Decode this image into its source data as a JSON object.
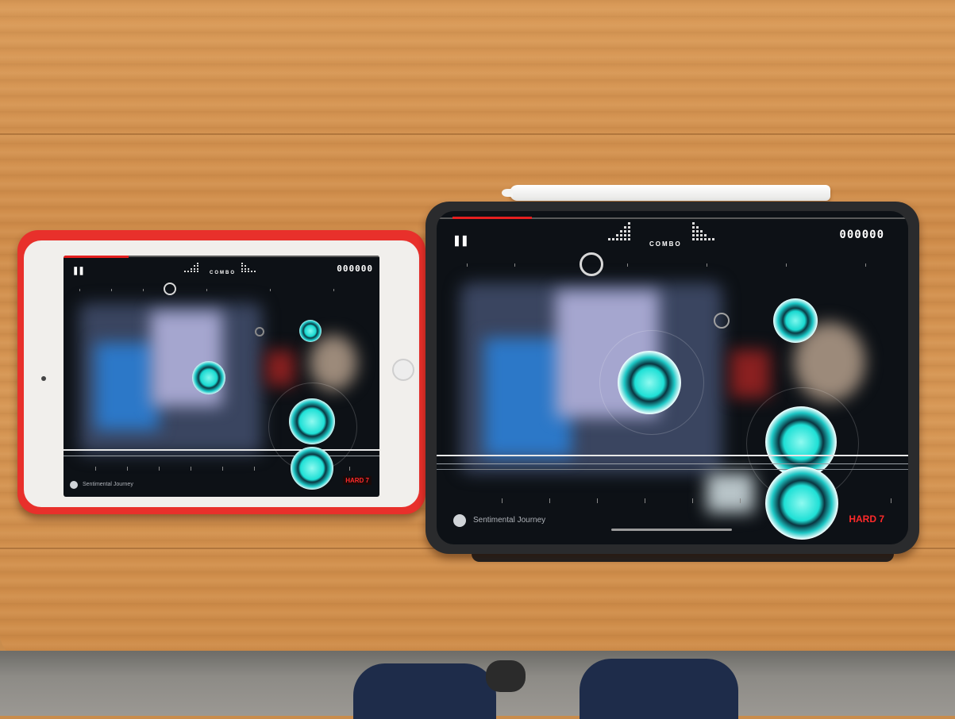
{
  "game": {
    "song_title": "Sentimental Journey",
    "difficulty": "HARD 7",
    "score": "000000",
    "combo_label": "COMBO",
    "pause_icon": "pause-icon",
    "progress": 0.18
  },
  "colors": {
    "note_fill": "#19d9d0",
    "note_core": "#5cf5e6",
    "difficulty": "#ff2a2a",
    "progress": "#e51f1f",
    "case": "#e8302b"
  }
}
